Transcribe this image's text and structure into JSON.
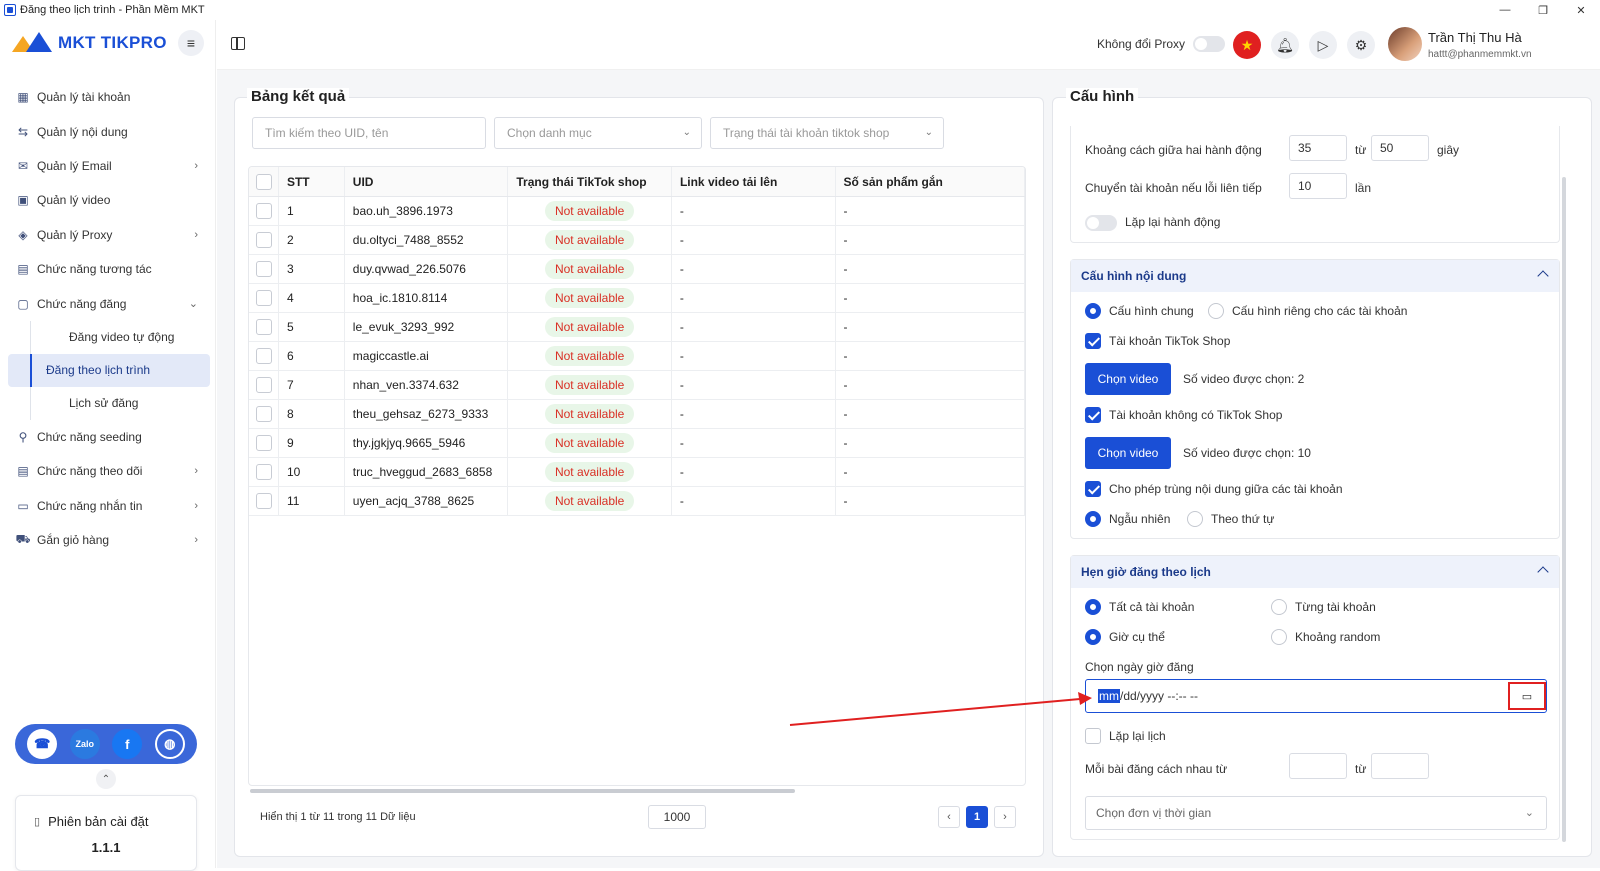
{
  "window": {
    "title": "Đăng theo lịch trình - Phần Mềm MKT",
    "controls": [
      "—",
      "❐",
      "✕"
    ]
  },
  "sidebar": {
    "logo": "MKT TIKPRO",
    "items": [
      {
        "label": "Quản lý tài khoản",
        "icon": "grid-icon",
        "chevron": ""
      },
      {
        "label": "Quản lý nội dung",
        "icon": "share-icon",
        "chevron": ""
      },
      {
        "label": "Quản lý Email",
        "icon": "mail-icon",
        "chevron": "›"
      },
      {
        "label": "Quản lý video",
        "icon": "video-icon",
        "chevron": ""
      },
      {
        "label": "Quản lý Proxy",
        "icon": "layers-icon",
        "chevron": "›"
      },
      {
        "label": "Chức năng tương tác",
        "icon": "interact-icon",
        "chevron": ""
      },
      {
        "label": "Chức năng đăng",
        "icon": "post-icon",
        "chevron": "⌄"
      }
    ],
    "subitems": [
      {
        "label": "Đăng video tự động"
      },
      {
        "label": "Đăng theo lịch trình"
      },
      {
        "label": "Lịch sử đăng"
      }
    ],
    "items2": [
      {
        "label": "Chức năng seeding",
        "icon": "seeding-icon",
        "chevron": ""
      },
      {
        "label": "Chức năng theo dõi",
        "icon": "follow-icon",
        "chevron": "›"
      },
      {
        "label": "Chức năng nhắn tin",
        "icon": "message-icon",
        "chevron": "›"
      },
      {
        "label": "Gắn giỏ hàng",
        "icon": "cart-icon",
        "chevron": "›"
      }
    ],
    "version_label": "Phiên bản cài đặt",
    "version": "1.1.1",
    "zalo_label": "Zalo"
  },
  "topbar": {
    "proxy_label": "Không đổi Proxy",
    "user_name": "Trần Thị Thu Hà",
    "user_email": "hattt@phanmemmkt.vn"
  },
  "results": {
    "title": "Bảng kết quả",
    "search_placeholder": "Tìm kiếm theo UID, tên",
    "category_placeholder": "Chọn danh mục",
    "status_placeholder": "Trạng thái tài khoản tiktok shop",
    "columns": [
      "STT",
      "UID",
      "Trạng thái TikTok shop",
      "Link video tải lên",
      "Số sản phẩm gắn"
    ],
    "rows": [
      {
        "stt": "1",
        "uid": "bao.uh_3896.1973",
        "status": "Not available",
        "link": "-",
        "count": "-"
      },
      {
        "stt": "2",
        "uid": "du.oltyci_7488_8552",
        "status": "Not available",
        "link": "-",
        "count": "-"
      },
      {
        "stt": "3",
        "uid": "duy.qvwad_226.5076",
        "status": "Not available",
        "link": "-",
        "count": "-"
      },
      {
        "stt": "4",
        "uid": "hoa_ic.1810.8114",
        "status": "Not available",
        "link": "-",
        "count": "-"
      },
      {
        "stt": "5",
        "uid": "le_evuk_3293_992",
        "status": "Not available",
        "link": "-",
        "count": "-"
      },
      {
        "stt": "6",
        "uid": "magiccastle.ai",
        "status": "Not available",
        "link": "-",
        "count": "-"
      },
      {
        "stt": "7",
        "uid": "nhan_ven.3374.632",
        "status": "Not available",
        "link": "-",
        "count": "-"
      },
      {
        "stt": "8",
        "uid": "theu_gehsaz_6273_9333",
        "status": "Not available",
        "link": "-",
        "count": "-"
      },
      {
        "stt": "9",
        "uid": "thy.jgkjyq.9665_5946",
        "status": "Not available",
        "link": "-",
        "count": "-"
      },
      {
        "stt": "10",
        "uid": "truc_hveggud_2683_6858",
        "status": "Not available",
        "link": "-",
        "count": "-"
      },
      {
        "stt": "11",
        "uid": "uyen_acjq_3788_8625",
        "status": "Not available",
        "link": "-",
        "count": "-"
      }
    ],
    "footer_text": "Hiển thị 1 từ 11 trong 11 Dữ liệu",
    "page_size": "1000",
    "current_page": "1",
    "prev": "‹",
    "next": "›"
  },
  "config": {
    "title": "Cấu hình",
    "general": {
      "gap_label": "Khoảng cách giữa hai hành động",
      "gap_from": "35",
      "gap_to_label": "từ",
      "gap_to": "50",
      "gap_unit": "giây",
      "switch_label": "Chuyển tài khoản nếu lỗi liên tiếp",
      "switch_value": "10",
      "switch_unit": "lần",
      "repeat_label": "Lặp lại hành động"
    },
    "content": {
      "title": "Cấu hình nội dung",
      "opt_common": "Cấu hình chung",
      "opt_private": "Cấu hình riêng cho các tài khoản",
      "shop_label": "Tài khoản TikTok Shop",
      "choose_video": "Chọn video",
      "shop_count": "Số video được chọn: 2",
      "noshop_label": "Tài khoản không có TikTok Shop",
      "noshop_count": "Số video được chọn: 10",
      "allow_dup": "Cho phép trùng nội dung giữa các tài khoản",
      "random": "Ngẫu nhiên",
      "ordered": "Theo thứ tự"
    },
    "schedule": {
      "title": "Hẹn giờ đăng theo lịch",
      "all_accounts": "Tất cả tài khoản",
      "each_account": "Từng tài khoản",
      "specific_time": "Giờ cụ thể",
      "random_range": "Khoảng random",
      "date_label": "Chọn ngày giờ đăng",
      "date_mm": "mm",
      "date_rest": "/dd/yyyy --:-- --",
      "repeat": "Lặp lại lịch",
      "gap_label": "Mỗi bài đăng cách nhau từ",
      "gap_to_label": "từ",
      "unit_placeholder": "Chọn đơn vị thời gian"
    }
  },
  "colors": {
    "accent": "#1a4fd6",
    "badge_text": "#d93025",
    "badge_bg": "#e8f6e8",
    "annotation": "#e02020"
  }
}
